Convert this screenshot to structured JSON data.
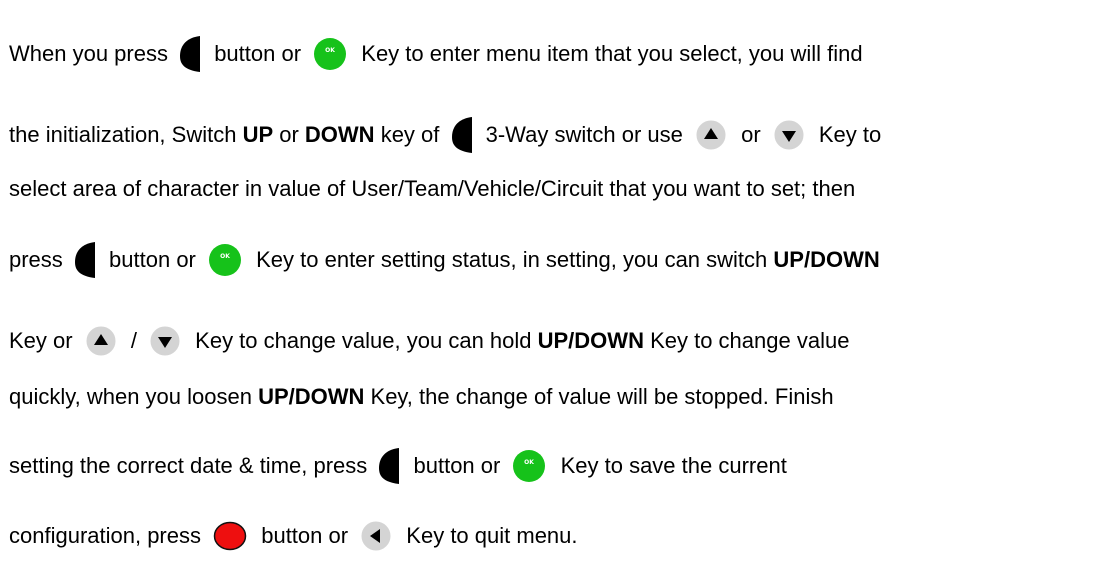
{
  "icons": {
    "left_switch": "half-circle-switch-icon",
    "ok_key": "green-ok-key-icon",
    "up_key": "up-arrow-key-icon",
    "down_key": "down-arrow-key-icon",
    "back_key": "left-arrow-key-icon",
    "red_button": "red-button-icon",
    "ok_label": "OK"
  },
  "colors": {
    "ok_green": "#16c21a",
    "red_button": "#ee0f0f",
    "key_gray": "#d4d4d4",
    "text": "#000000"
  },
  "paragraph": {
    "l1": {
      "t1": "When you press ",
      "t2": " button or ",
      "t3": " Key to enter menu item that you select, you will find"
    },
    "l2": {
      "t1": "the initialization, Switch ",
      "b1": "UP",
      "t2": " or ",
      "b2": "DOWN",
      "t3": " key of ",
      "t4": " 3-Way switch or use ",
      "t5": " or ",
      "t6": " Key to"
    },
    "l3": {
      "t1": "select area of character in value of User/Team/Vehicle/Circuit that you want to set; then"
    },
    "l4": {
      "t1": "press ",
      "t2": " button or ",
      "t3": " Key to enter setting status, in setting, you can switch ",
      "b1": "UP/DOWN"
    },
    "l5": {
      "t1": "Key or ",
      "t2": " / ",
      "t3": " Key to change value, you can hold ",
      "b1": "UP/DOWN",
      "t4": " Key to change value"
    },
    "l6": {
      "t1": "quickly, when you loosen ",
      "b1": "UP/DOWN",
      "t2": " Key, the change of value will be stopped. Finish"
    },
    "l7": {
      "t1": "setting the correct date & time, press ",
      "t2": " button or ",
      "t3": " Key to save the current"
    },
    "l8": {
      "t1": "configuration, press ",
      "t2": " button or ",
      "t3": " Key to quit menu."
    }
  }
}
